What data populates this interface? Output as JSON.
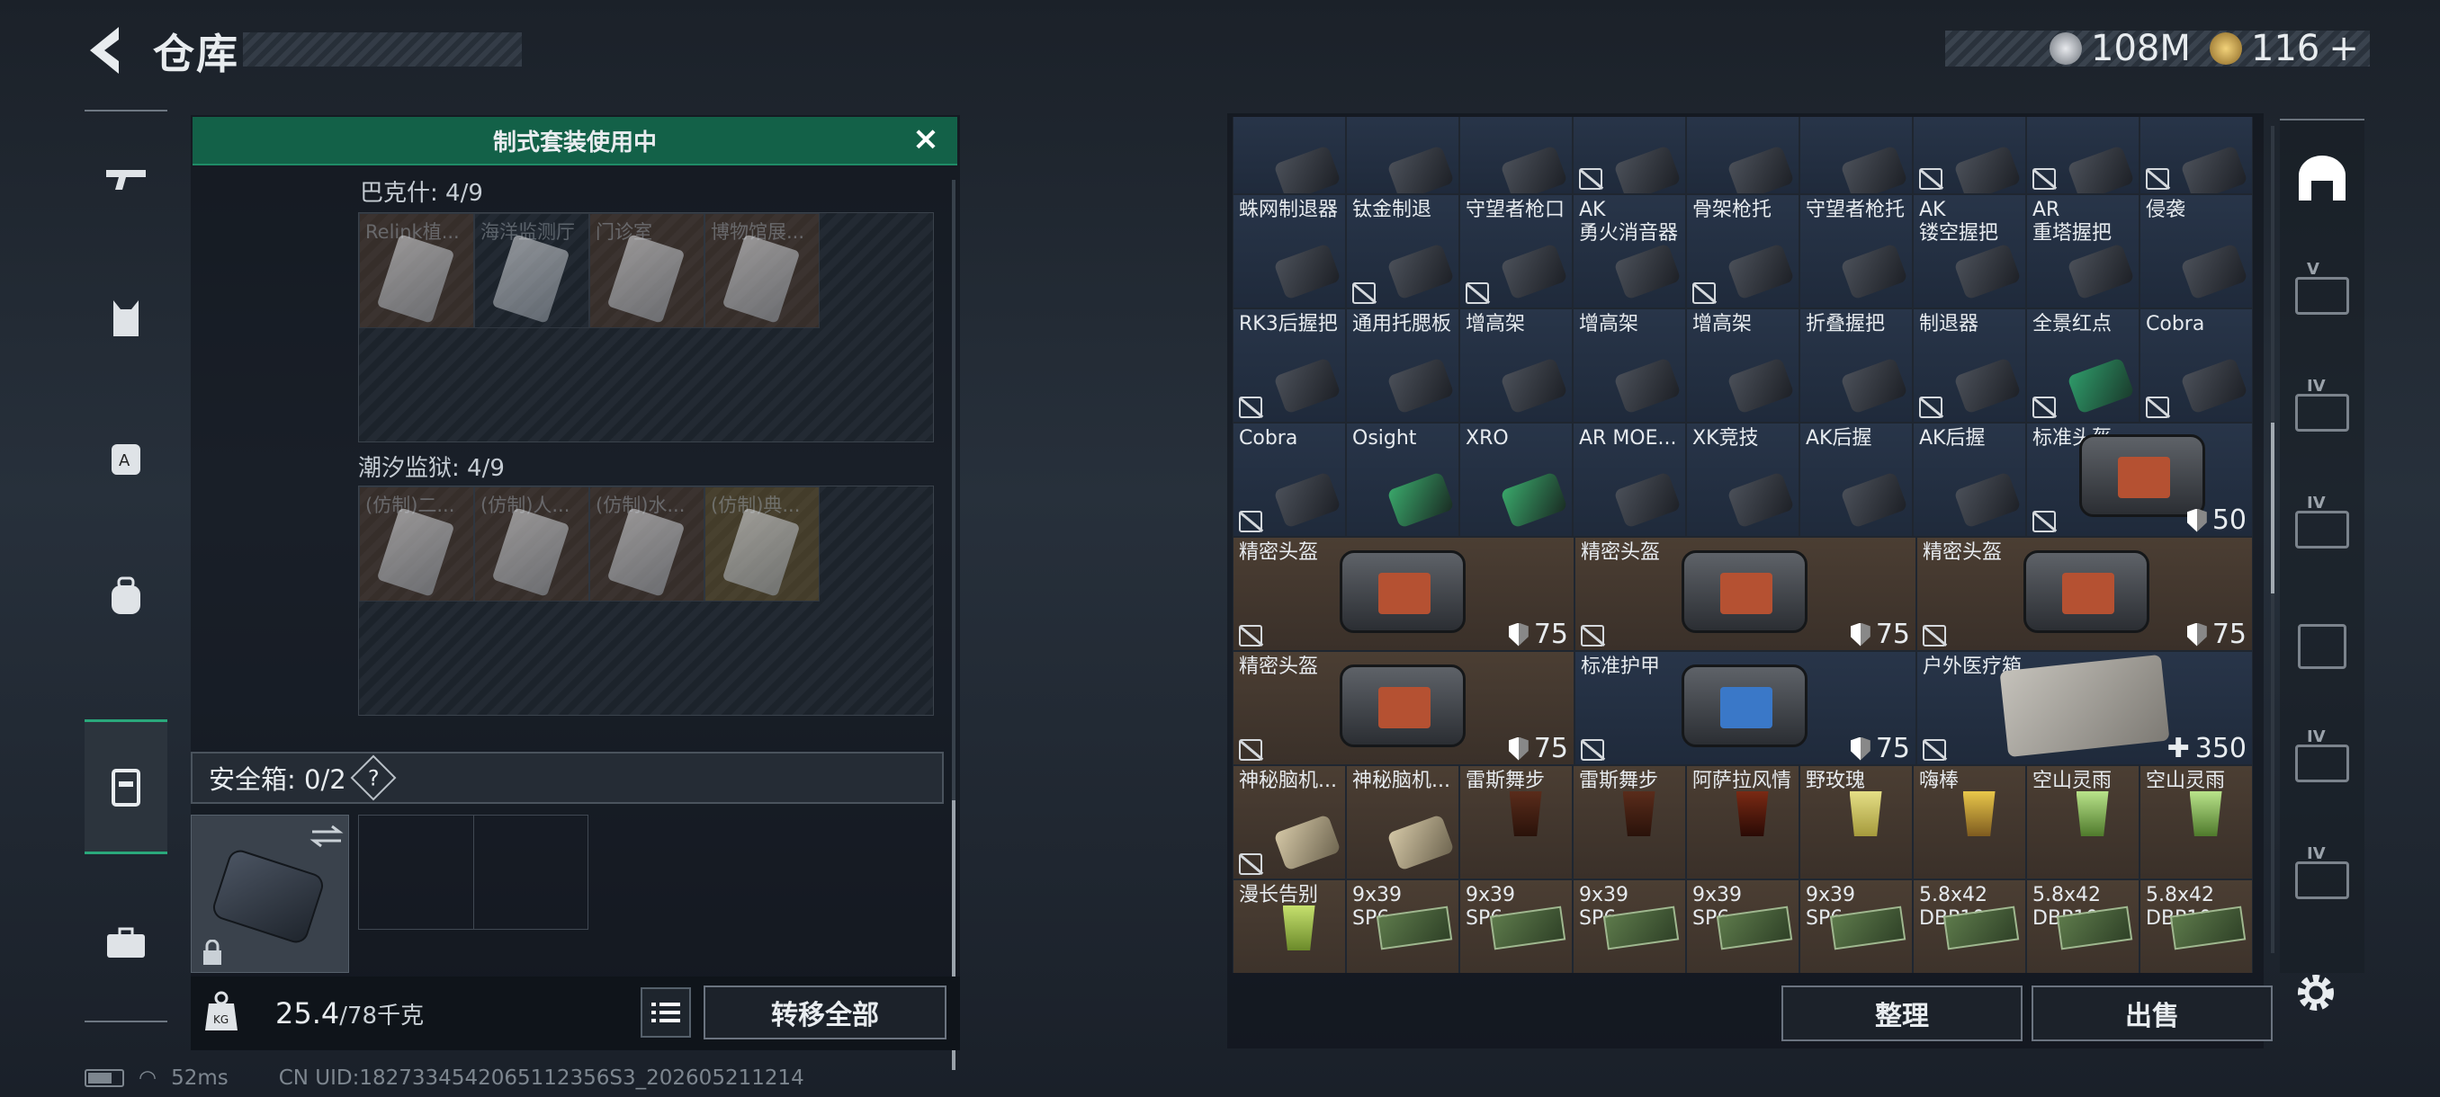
{
  "header": {
    "title": "仓库",
    "silver": "108M",
    "gold": "116",
    "gold_plus": "+"
  },
  "nav": {
    "items": [
      "weapon",
      "vest",
      "armor",
      "backpack",
      "case",
      "toolbox"
    ],
    "selected": 4
  },
  "left": {
    "banner": "制式套装使用中",
    "group1": {
      "label": "巴克什: 4/9",
      "items": [
        "Relink植...",
        "海洋监测厅",
        "门诊室",
        "博物馆展..."
      ]
    },
    "group2": {
      "label": "潮汐监狱: 4/9",
      "items": [
        "(仿制)二...",
        "(仿制)人...",
        "(仿制)水...",
        "(仿制)典..."
      ]
    },
    "safe_label": "安全箱: 0/2",
    "help": "?",
    "weight": "25.4",
    "weight_max": "/78千克",
    "transfer_all": "转移全部"
  },
  "inventory": {
    "row0": [
      "",
      "",
      "",
      "",
      "",
      "",
      "",
      "",
      ""
    ],
    "row1": [
      "蛛网制退器",
      "钛金制退",
      "守望者枪口",
      "AK\n勇火消音器",
      "骨架枪托",
      "守望者枪托",
      "AK\n镂空握把",
      "AR\n重塔握把",
      "侵袭"
    ],
    "row2": [
      "RK3后握把",
      "通用托腮板",
      "增高架",
      "增高架",
      "增高架",
      "折叠握把",
      "制退器",
      "全景红点",
      "Cobra"
    ],
    "row3": [
      "Cobra",
      "Osight",
      "XRO",
      "AR MOE...",
      "XK竞技",
      "AK后握",
      "AK后握",
      "标准头盔"
    ],
    "row3_value": "50",
    "row4": [
      {
        "name": "精密头盔",
        "value": "75"
      },
      {
        "name": "精密头盔",
        "value": "75"
      },
      {
        "name": "精密头盔",
        "value": "75"
      }
    ],
    "row5": [
      {
        "name": "精密头盔",
        "value": "75"
      },
      {
        "name": "标准护甲",
        "value": "75"
      },
      {
        "name": "户外医疗箱",
        "value": "350"
      }
    ],
    "row6": [
      "神秘脑机...",
      "神秘脑机...",
      "雷斯舞步",
      "雷斯舞步",
      "阿萨拉风情",
      "野玫瑰",
      "嗨棒",
      "空山灵雨",
      "空山灵雨"
    ],
    "row7": [
      "漫长告别",
      "9x39\nSP6",
      "9x39\nSP6",
      "9x39\nSP6",
      "9x39\nSP6",
      "9x39\nSP6",
      "5.8x42\nDBP10",
      "5.8x42\nDBP10",
      "5.8x42\nDBP10"
    ],
    "sort": "整理",
    "sell": "出售"
  },
  "tabs": {
    "levels": [
      "",
      "V",
      "IV",
      "IV",
      "",
      "IV",
      "IV"
    ]
  },
  "status": {
    "ping": "52ms",
    "uid": "CN UID:1827334542065112356S3_202605211214"
  },
  "colors": {
    "accent": "#136148",
    "blue_cell": "#283549",
    "brown_cell": "#4b3e33"
  }
}
